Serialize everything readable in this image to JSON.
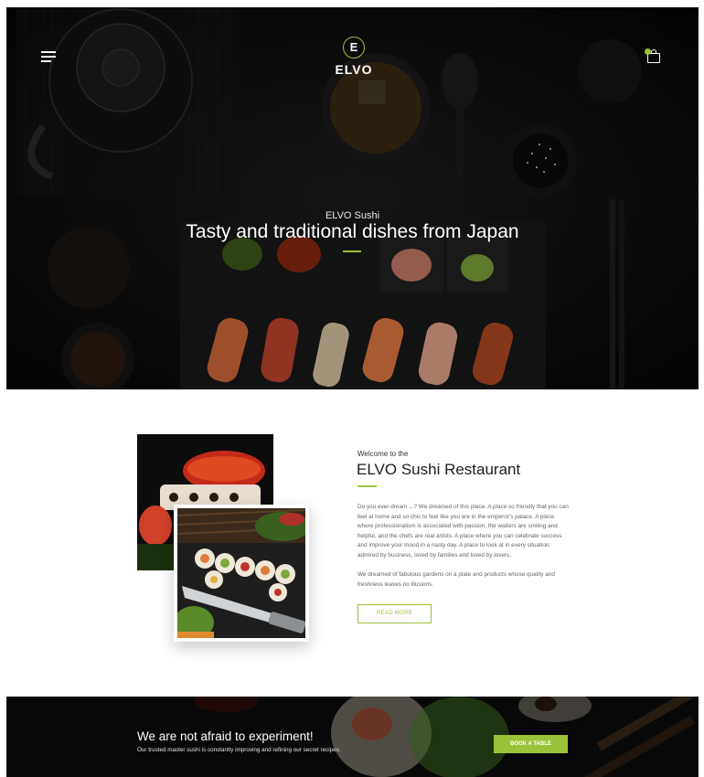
{
  "header": {
    "logo_letter": "E",
    "logo_text": "ELVO"
  },
  "hero": {
    "eyebrow": "ELVO Sushi",
    "title": "Tasty and traditional dishes from Japan"
  },
  "about": {
    "eyebrow": "Welcome to the",
    "title": "ELVO Sushi Restaurant",
    "paragraph_1": "Do you ever dream ...? We dreamed of this place. A place so friendly that you can feel at home and so chic to feel like you are in the emperor's palace. A place where professionalism is associated with passion, the waiters are smiling and helpful, and the chefs are real artists. A place where you can celebrate success and improve your mood in a nasty day. A place to look at in every situation: admired by business, loved by families and loved by lovers.",
    "paragraph_2": "We dreamed of fabulous gardens on a plate and products whose quality and freshness leaves no illusions.",
    "read_more_label": "READ MORE"
  },
  "cta": {
    "title": "We are not afraid to experiment!",
    "subtitle": "Our trusted master sushi is constantly improving and refining our secret recipes.",
    "book_label": "BOOK A TABLE"
  },
  "colors": {
    "accent": "#9bc23b",
    "dark_bg": "#0b0b0b"
  },
  "icons": {
    "menu": "hamburger-menu-icon",
    "cart": "shopping-bag-icon"
  }
}
